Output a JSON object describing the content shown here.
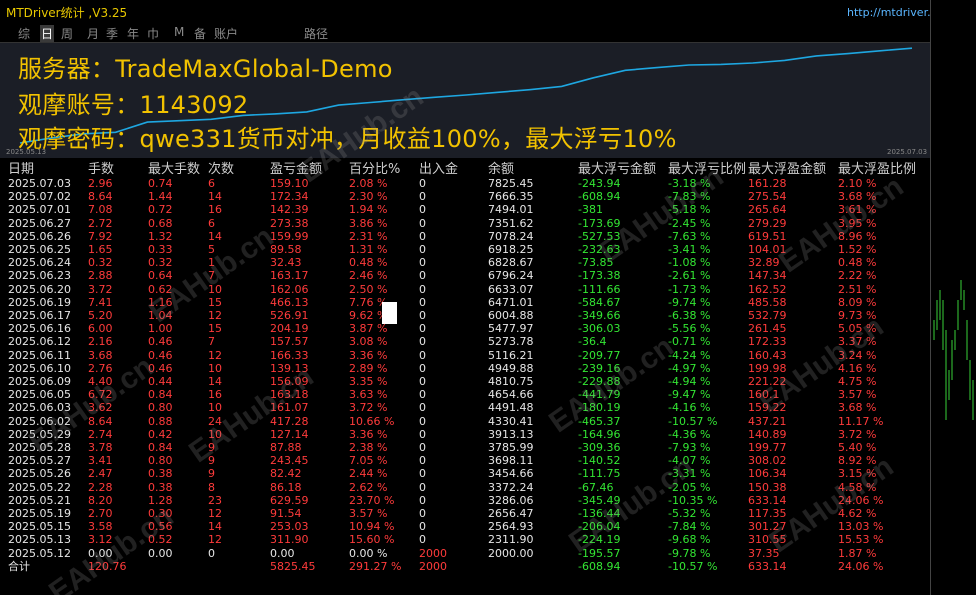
{
  "window": {
    "title": "MTDriver统计 ,V3.25",
    "url": "http://mtdriver.cn",
    "close_glyph": "✕",
    "right_label": "观"
  },
  "tabs": [
    "综",
    "日",
    "周",
    "月",
    "季",
    "年",
    "巾",
    "M",
    "备",
    "账户",
    "",
    "路径"
  ],
  "active_tab": 1,
  "info": {
    "server": "服务器：TradeMaxGlobal-Demo",
    "account": "观摩账号：1143092",
    "password": "观摩密码：qwe331货币对冲，月收益100%，最大浮亏10%"
  },
  "equity_axis": {
    "start": "2025.05.13",
    "end": "2025.07.03"
  },
  "equity_curve": [
    2000,
    2311.9,
    2564.93,
    2656.47,
    3286.06,
    3372.24,
    3454.66,
    3698.11,
    3785.99,
    3913.13,
    4330.41,
    4491.48,
    4654.66,
    4810.75,
    4949.88,
    5116.21,
    5273.78,
    5477.97,
    6004.88,
    6471.01,
    6633.07,
    6796.24,
    6828.67,
    6918.25,
    7078.24,
    7351.62,
    7494.01,
    7666.35,
    7825.45
  ],
  "watermark": "EAHub.cn",
  "columns": [
    "日期",
    "手数",
    "最大手数",
    "次数",
    "盈亏金额",
    "百分比%",
    "出入金",
    "余额",
    "最大浮亏金额",
    "最大浮亏比例",
    "最大浮盈金额",
    "最大浮盈比例"
  ],
  "rows": [
    [
      "2025.07.03",
      "2.96",
      "0.74",
      "6",
      "159.10",
      "2.08 %",
      "0",
      "7825.45",
      "-243.94",
      "-3.18 %",
      "161.28",
      "2.10 %"
    ],
    [
      "2025.07.02",
      "8.64",
      "1.44",
      "14",
      "172.34",
      "2.30 %",
      "0",
      "7666.35",
      "-608.94",
      "-7.83 %",
      "275.54",
      "3.68 %"
    ],
    [
      "2025.07.01",
      "7.08",
      "0.72",
      "16",
      "142.39",
      "1.94 %",
      "0",
      "7494.01",
      "-381",
      "-5.18 %",
      "265.64",
      "3.61 %"
    ],
    [
      "2025.06.27",
      "2.72",
      "0.68",
      "6",
      "273.38",
      "3.86 %",
      "0",
      "7351.62",
      "-173.69",
      "-2.45 %",
      "279.29",
      "3.95 %"
    ],
    [
      "2025.06.26",
      "7.92",
      "1.32",
      "14",
      "159.99",
      "2.31 %",
      "0",
      "7078.24",
      "-527.53",
      "-7.63 %",
      "619.51",
      "8.96 %"
    ],
    [
      "2025.06.25",
      "1.65",
      "0.33",
      "5",
      "89.58",
      "1.31 %",
      "0",
      "6918.25",
      "-232.63",
      "-3.41 %",
      "104.01",
      "1.52 %"
    ],
    [
      "2025.06.24",
      "0.32",
      "0.32",
      "1",
      "32.43",
      "0.48 %",
      "0",
      "6828.67",
      "-73.85",
      "-1.08 %",
      "32.89",
      "0.48 %"
    ],
    [
      "2025.06.23",
      "2.88",
      "0.64",
      "7",
      "163.17",
      "2.46 %",
      "0",
      "6796.24",
      "-173.38",
      "-2.61 %",
      "147.34",
      "2.22 %"
    ],
    [
      "2025.06.20",
      "3.72",
      "0.62",
      "10",
      "162.06",
      "2.50 %",
      "0",
      "6633.07",
      "-111.66",
      "-1.73 %",
      "162.52",
      "2.51 %"
    ],
    [
      "2025.06.19",
      "7.41",
      "1.16",
      "15",
      "466.13",
      "7.76 %",
      "0",
      "6471.01",
      "-584.67",
      "-9.74 %",
      "485.58",
      "8.09 %"
    ],
    [
      "2025.06.17",
      "5.20",
      "1.04",
      "12",
      "526.91",
      "9.62 %",
      "0",
      "6004.88",
      "-349.66",
      "-6.38 %",
      "532.79",
      "9.73 %"
    ],
    [
      "2025.06.16",
      "6.00",
      "1.00",
      "15",
      "204.19",
      "3.87 %",
      "0",
      "5477.97",
      "-306.03",
      "-5.56 %",
      "261.45",
      "5.05 %"
    ],
    [
      "2025.06.12",
      "2.16",
      "0.46",
      "7",
      "157.57",
      "3.08 %",
      "0",
      "5273.78",
      "-36.4",
      "-0.71 %",
      "172.33",
      "3.37 %"
    ],
    [
      "2025.06.11",
      "3.68",
      "0.46",
      "12",
      "166.33",
      "3.36 %",
      "0",
      "5116.21",
      "-209.77",
      "-4.24 %",
      "160.43",
      "3.24 %"
    ],
    [
      "2025.06.10",
      "2.76",
      "0.46",
      "10",
      "139.13",
      "2.89 %",
      "0",
      "4949.88",
      "-239.16",
      "-4.97 %",
      "199.98",
      "4.16 %"
    ],
    [
      "2025.06.09",
      "4.40",
      "0.44",
      "14",
      "156.09",
      "3.35 %",
      "0",
      "4810.75",
      "-229.88",
      "-4.94 %",
      "221.22",
      "4.75 %"
    ],
    [
      "2025.06.05",
      "6.72",
      "0.84",
      "16",
      "163.18",
      "3.63 %",
      "0",
      "4654.66",
      "-441.79",
      "-9.47 %",
      "160.1",
      "3.57 %"
    ],
    [
      "2025.06.03",
      "3.62",
      "0.80",
      "10",
      "161.07",
      "3.72 %",
      "0",
      "4491.48",
      "-180.19",
      "-4.16 %",
      "159.22",
      "3.68 %"
    ],
    [
      "2025.06.02",
      "8.64",
      "0.88",
      "24",
      "417.28",
      "10.66 %",
      "0",
      "4330.41",
      "-465.37",
      "-10.57 %",
      "437.21",
      "11.17 %"
    ],
    [
      "2025.05.29",
      "2.74",
      "0.42",
      "10",
      "127.14",
      "3.36 %",
      "0",
      "3913.13",
      "-164.96",
      "-4.36 %",
      "140.89",
      "3.72 %"
    ],
    [
      "2025.05.28",
      "3.78",
      "0.84",
      "9",
      "87.88",
      "2.38 %",
      "0",
      "3785.99",
      "-309.36",
      "-7.93 %",
      "199.77",
      "5.40 %"
    ],
    [
      "2025.05.27",
      "3.41",
      "0.80",
      "9",
      "243.45",
      "7.05 %",
      "0",
      "3698.11",
      "-140.52",
      "-4.07 %",
      "308.02",
      "8.92 %"
    ],
    [
      "2025.05.26",
      "2.47",
      "0.38",
      "9",
      "82.42",
      "2.44 %",
      "0",
      "3454.66",
      "-111.75",
      "-3.31 %",
      "106.34",
      "3.15 %"
    ],
    [
      "2025.05.22",
      "2.28",
      "0.38",
      "8",
      "86.18",
      "2.62 %",
      "0",
      "3372.24",
      "-67.46",
      "-2.05 %",
      "150.38",
      "4.58 %"
    ],
    [
      "2025.05.21",
      "8.20",
      "1.28",
      "23",
      "629.59",
      "23.70 %",
      "0",
      "3286.06",
      "-345.49",
      "-10.35 %",
      "633.14",
      "24.06 %"
    ],
    [
      "2025.05.19",
      "2.70",
      "0.30",
      "12",
      "91.54",
      "3.57 %",
      "0",
      "2656.47",
      "-136.44",
      "-5.32 %",
      "117.35",
      "4.62 %"
    ],
    [
      "2025.05.15",
      "3.58",
      "0.56",
      "14",
      "253.03",
      "10.94 %",
      "0",
      "2564.93",
      "-206.04",
      "-7.84 %",
      "301.27",
      "13.03 %"
    ],
    [
      "2025.05.13",
      "3.12",
      "0.52",
      "12",
      "311.90",
      "15.60 %",
      "0",
      "2311.90",
      "-224.19",
      "-9.68 %",
      "310.55",
      "15.53 %"
    ],
    [
      "2025.05.12",
      "0.00",
      "0.00",
      "0",
      "0.00",
      "0.00 %",
      "2000",
      "2000.00",
      "-195.57",
      "-9.78 %",
      "37.35",
      "1.87 %"
    ]
  ],
  "total": [
    "合计",
    "120.76",
    "",
    "",
    "5825.45",
    "291.27 %",
    "2000",
    "",
    "-608.94",
    "-10.57 %",
    "633.14",
    "24.06 %"
  ],
  "colors": {
    "bg": "#000000",
    "panel": "#1b1e26",
    "gold": "#f2c200",
    "white": "#e6e6e6",
    "red": "#ff3b3b",
    "green": "#33e633",
    "blue": "#1ea7e1",
    "curve": "#1ea7e1"
  }
}
